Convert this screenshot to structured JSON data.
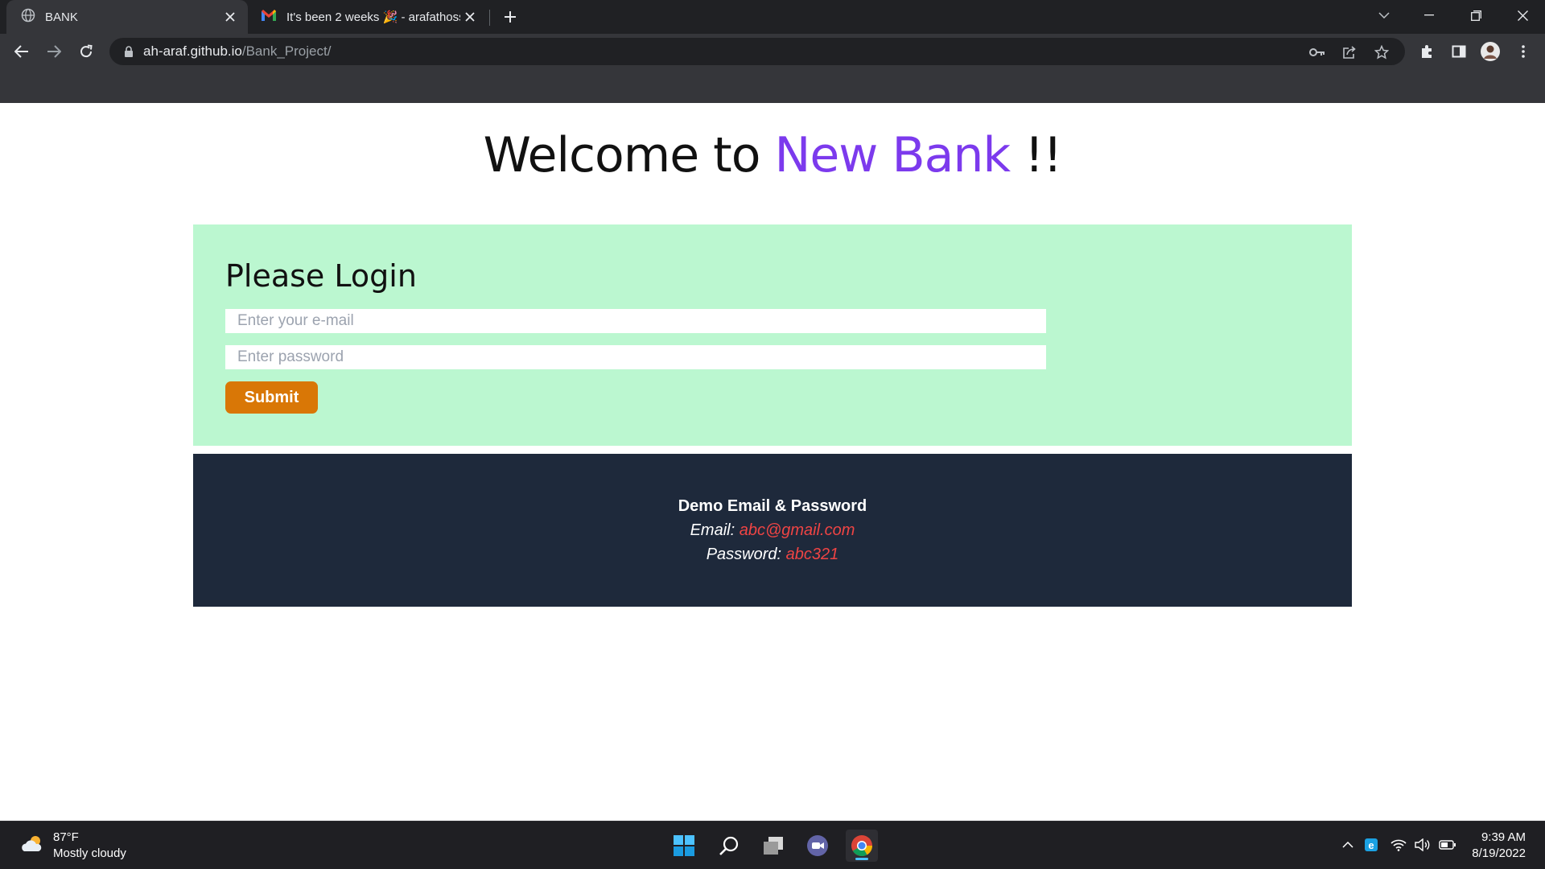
{
  "browser": {
    "tabs": [
      {
        "title": "BANK",
        "icon": "globe-icon",
        "active": true
      },
      {
        "title": "It's been 2 weeks 🎉 - arafathoss",
        "icon": "gmail-icon",
        "active": false
      }
    ],
    "url_host": "ah-araf.github.io",
    "url_path": "/Bank_Project/"
  },
  "page": {
    "heading_prefix": "Welcome to ",
    "heading_accent": "New Bank",
    "heading_suffix": " !!",
    "accent_color": "#7c3aed",
    "login": {
      "title": "Please Login",
      "email_placeholder": "Enter your e-mail",
      "password_placeholder": "Enter password",
      "submit_label": "Submit"
    },
    "demo": {
      "title": "Demo Email & Password",
      "email_label": "Email:",
      "email_value": "abc@gmail.com",
      "password_label": "Password:",
      "password_value": "abc321"
    }
  },
  "taskbar": {
    "weather_temp": "87°F",
    "weather_desc": "Mostly cloudy",
    "time": "9:39 AM",
    "date": "8/19/2022"
  }
}
